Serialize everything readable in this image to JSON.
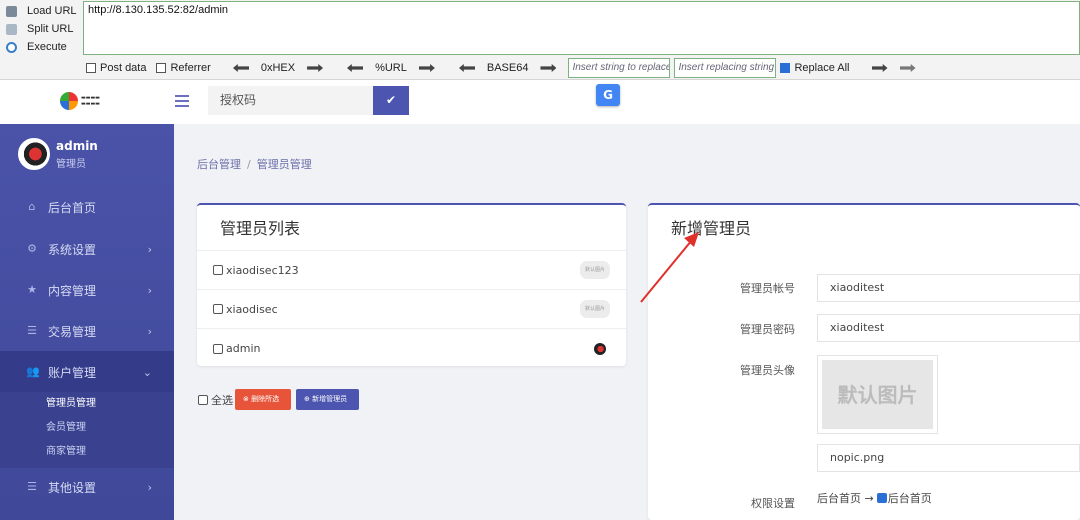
{
  "hackbar": {
    "actions": [
      {
        "label": "Load URL",
        "icon": "load-url-icon"
      },
      {
        "label": "Split URL",
        "icon": "split-url-icon"
      },
      {
        "label": "Execute",
        "icon": "execute-icon"
      }
    ],
    "url": "http://8.130.135.52:82/admin",
    "post_data": "Post data",
    "referrer": "Referrer",
    "hex": "0xHEX",
    "url_enc": "%URL",
    "base64": "BASE64",
    "insert_placeholder": "Insert string to replace",
    "replacing_placeholder": "Insert replacing string",
    "replace_all": "Replace All"
  },
  "appbar": {
    "auth_placeholder": "授权码",
    "auth_button": "✔",
    "translate_icon": "G"
  },
  "sidebar": {
    "user_name": "admin",
    "user_role": "管理员",
    "items": [
      {
        "label": "后台首页",
        "icon": "⌂"
      },
      {
        "label": "系统设置",
        "icon": "⚙"
      },
      {
        "label": "内容管理",
        "icon": "★"
      },
      {
        "label": "交易管理",
        "icon": "☰"
      },
      {
        "label": "账户管理",
        "icon": "👥"
      },
      {
        "label": "其他设置",
        "icon": "☰"
      }
    ],
    "sub_items": [
      "管理员管理",
      "会员管理",
      "商家管理"
    ]
  },
  "breadcrumb": {
    "root": "后台管理",
    "current": "管理员管理"
  },
  "list_panel": {
    "title": "管理员列表",
    "rows": [
      {
        "name": "xiaodisec123",
        "thumb": "默认图片"
      },
      {
        "name": "xiaodisec",
        "thumb": "默认图片"
      },
      {
        "name": "admin",
        "thumb": ""
      }
    ],
    "select_all": "全选",
    "delete_button": "⊗ 删除所选",
    "add_button": "⊕ 新增管理员"
  },
  "add_panel": {
    "title": "新增管理员",
    "account_label": "管理员帐号",
    "account_value": "xiaoditest",
    "password_label": "管理员密码",
    "password_value": "xiaoditest",
    "avatar_label": "管理员头像",
    "avatar_placeholder": "默认图片",
    "avatar_file": "nopic.png",
    "perm_label": "权限设置",
    "perm_text": "后台首页 →",
    "perm_checked": "后台首页"
  },
  "colors": {
    "accent": "#4c55b0",
    "danger": "#e8543a",
    "sidebar": "#4a53a8"
  }
}
